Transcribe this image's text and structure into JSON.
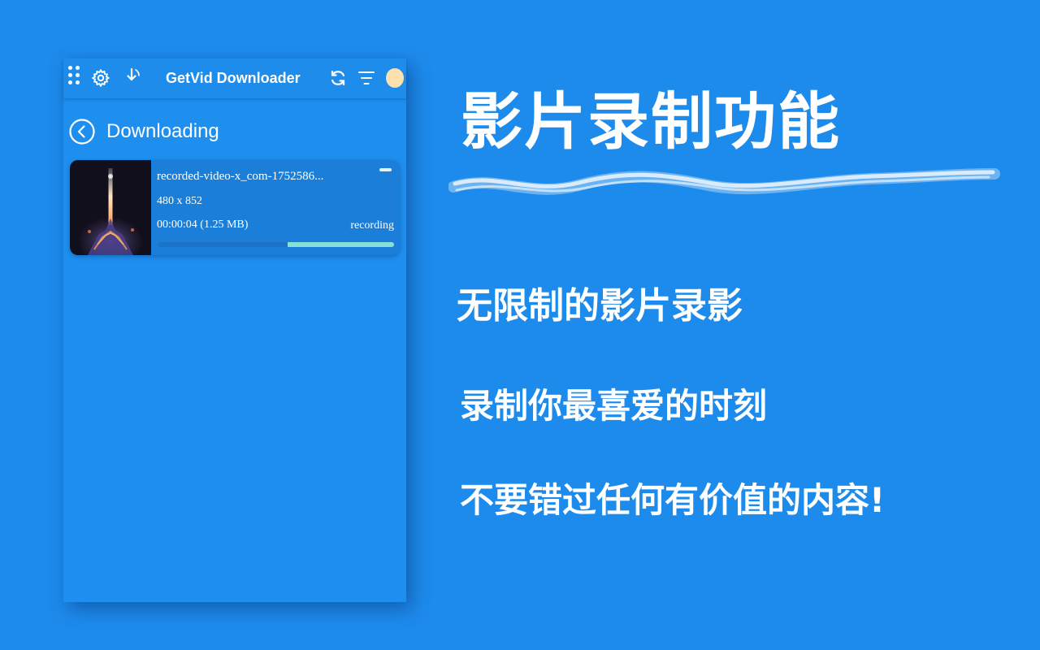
{
  "app": {
    "title": "GetVid Downloader"
  },
  "toolbar": {
    "icons": [
      "apps-grid-icon",
      "gear-icon",
      "download-icon",
      "refresh-icon",
      "filter-icon",
      "avatar"
    ]
  },
  "section": {
    "title": "Downloading"
  },
  "downloads": [
    {
      "filename": "recorded-video-x_com-1752586...",
      "resolution": "480 x 852",
      "duration_size": "00:00:04 (1.25 MB)",
      "status": "recording",
      "progress": 0.55
    }
  ],
  "promo": {
    "heading": "影片录制功能",
    "line1": "无限制的影片录影",
    "line2": "录制你最喜爱的时刻",
    "line3": "不要错过任何有价值的内容!"
  },
  "colors": {
    "background": "#1d8bec",
    "panel": "#1e8fee",
    "card": "#1b7fd9",
    "progress_track": "#86e0d8",
    "progress_fill": "#1a73c9",
    "avatar": "#fde0b0"
  }
}
